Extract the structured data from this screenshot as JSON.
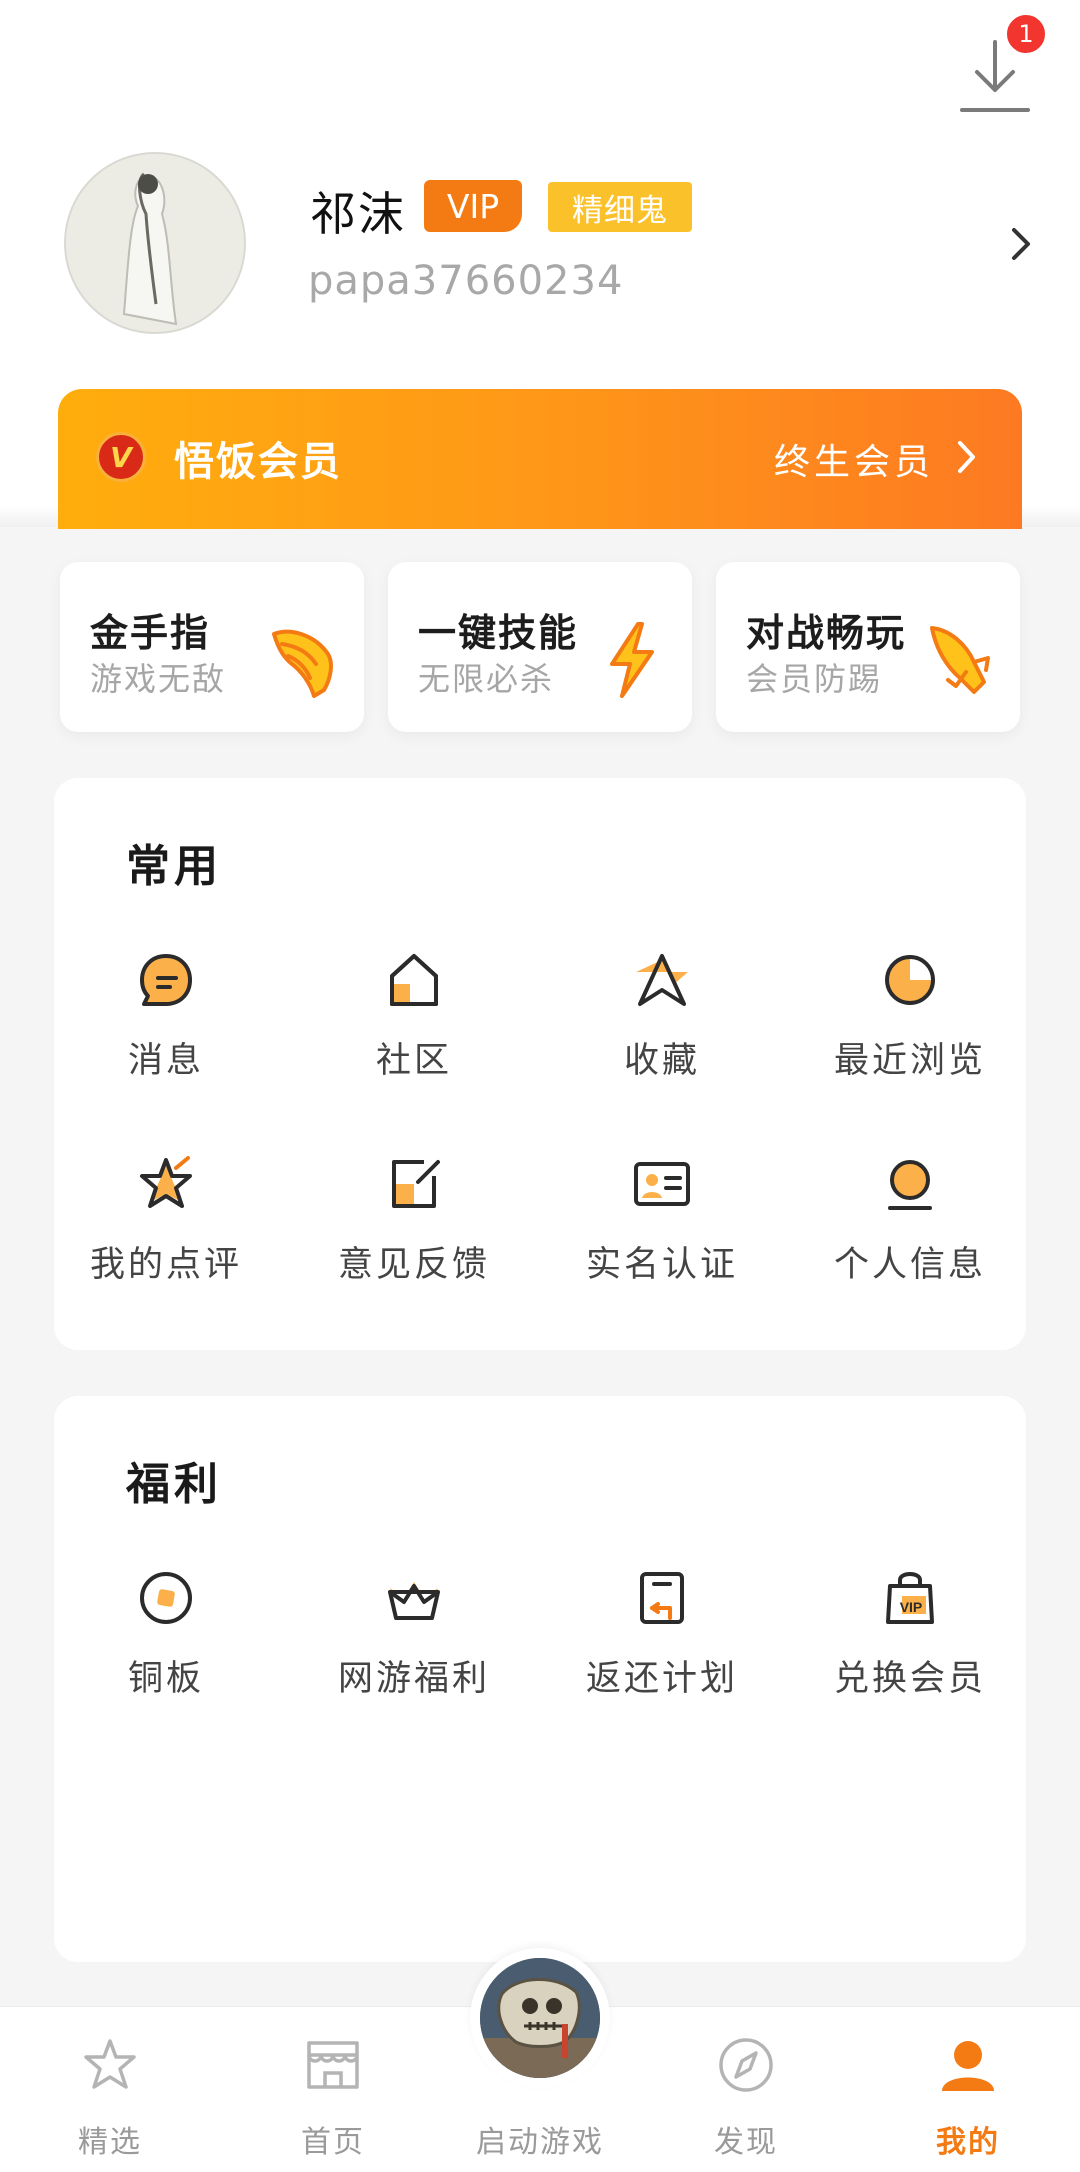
{
  "header": {
    "download_badge_count": "1",
    "username": "祁沫",
    "vip_badge": "VIP",
    "level_badge": "精细鬼",
    "user_id": "papa37660234"
  },
  "membership": {
    "logo_letter": "V",
    "title": "悟饭会员",
    "status": "终生会员"
  },
  "features": [
    {
      "title": "金手指",
      "subtitle": "游戏无敌",
      "icon": "wing-icon"
    },
    {
      "title": "一键技能",
      "subtitle": "无限必杀",
      "icon": "lightning-icon"
    },
    {
      "title": "对战畅玩",
      "subtitle": "会员防踢",
      "icon": "rocket-icon"
    }
  ],
  "common": {
    "title": "常用",
    "items": [
      {
        "label": "消息",
        "icon": "message-icon"
      },
      {
        "label": "社区",
        "icon": "community-icon"
      },
      {
        "label": "收藏",
        "icon": "favorite-icon"
      },
      {
        "label": "最近浏览",
        "icon": "history-icon"
      },
      {
        "label": "我的点评",
        "icon": "review-icon"
      },
      {
        "label": "意见反馈",
        "icon": "feedback-icon"
      },
      {
        "label": "实名认证",
        "icon": "id-card-icon"
      },
      {
        "label": "个人信息",
        "icon": "profile-icon"
      }
    ]
  },
  "welfare": {
    "title": "福利",
    "items": [
      {
        "label": "铜板",
        "icon": "coin-icon"
      },
      {
        "label": "网游福利",
        "icon": "crown-icon"
      },
      {
        "label": "返还计划",
        "icon": "refund-icon"
      },
      {
        "label": "兑换会员",
        "icon": "vip-bag-icon"
      }
    ]
  },
  "bottom_nav": {
    "active": "我的",
    "items": [
      {
        "label": "精选",
        "icon": "star-icon"
      },
      {
        "label": "首页",
        "icon": "store-icon"
      },
      {
        "label": "启动游戏",
        "icon": "game-cover-icon"
      },
      {
        "label": "发现",
        "icon": "compass-icon"
      },
      {
        "label": "我的",
        "icon": "user-icon"
      }
    ]
  },
  "colors": {
    "accent": "#f47b14",
    "vip_badge": "#f47b14",
    "level_badge": "#fbc12a",
    "banner_start": "#ffad0d",
    "banner_end": "#fd7a22",
    "badge_red": "#f2352e"
  }
}
